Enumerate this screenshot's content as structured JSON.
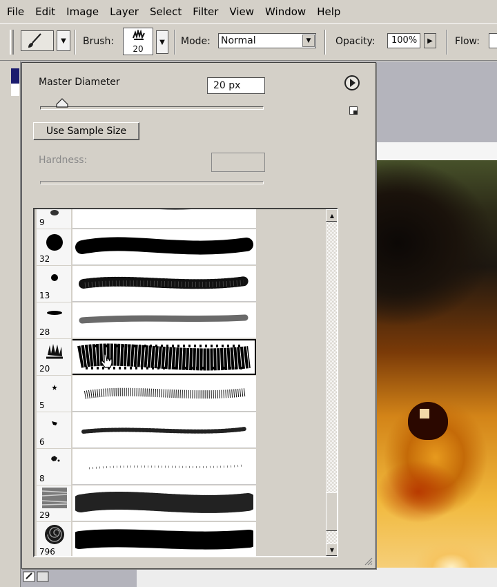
{
  "menu": [
    "File",
    "Edit",
    "Image",
    "Layer",
    "Select",
    "Filter",
    "View",
    "Window",
    "Help"
  ],
  "options_bar": {
    "brush_label": "Brush:",
    "brush_size": "20",
    "mode_label": "Mode:",
    "mode_value": "Normal",
    "opacity_label": "Opacity:",
    "opacity_value": "100%",
    "flow_label": "Flow:"
  },
  "brush_panel": {
    "master_diameter_label": "Master Diameter",
    "master_diameter_value": "20 px",
    "master_diameter_slider_fraction": 0.1,
    "use_sample_size_label": "Use Sample Size",
    "hardness_label": "Hardness:",
    "hardness_value": "",
    "selected_preset_size": "20",
    "presets": [
      {
        "size": "9",
        "thumb": "soft-round",
        "stroke": "solid-thin"
      },
      {
        "size": "32",
        "thumb": "hard-round",
        "stroke": "solid-thick"
      },
      {
        "size": "13",
        "thumb": "hard-round-small",
        "stroke": "speckled"
      },
      {
        "size": "28",
        "thumb": "flat-ellipse",
        "stroke": "gray-stroke"
      },
      {
        "size": "20",
        "thumb": "scatter-grass",
        "stroke": "rough-textured",
        "selected": true
      },
      {
        "size": "5",
        "thumb": "tiny-star",
        "stroke": "dry-brush"
      },
      {
        "size": "6",
        "thumb": "tiny-blot",
        "stroke": "chalk"
      },
      {
        "size": "8",
        "thumb": "splatter",
        "stroke": "dotted-faint"
      },
      {
        "size": "29",
        "thumb": "noise-texture",
        "stroke": "soft-textured"
      },
      {
        "size": "796",
        "thumb": "shell",
        "stroke": "solid-heavy"
      }
    ]
  },
  "icons": {
    "tool": "brush-icon",
    "panel_menu": "flyout-menu-icon",
    "new_preset": "new-preset-icon"
  },
  "colors": {
    "ui_gray": "#d4d0c8",
    "border_dark": "#404040"
  }
}
